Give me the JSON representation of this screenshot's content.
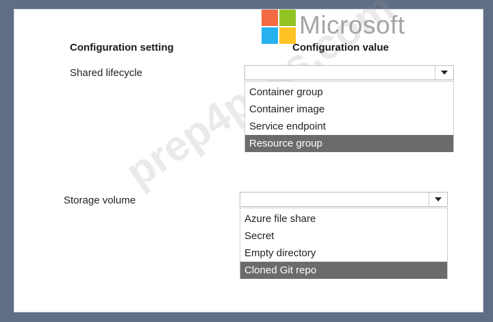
{
  "watermark": {
    "brand": "Microsoft",
    "site": "prep4pass.com",
    "logo_colors": [
      "#f25022",
      "#7fba00",
      "#00a4ef",
      "#ffb900"
    ]
  },
  "headers": {
    "setting": "Configuration setting",
    "value": "Configuration value"
  },
  "rows": [
    {
      "label": "Shared lifecycle",
      "selected_value": "",
      "options": [
        "Container group",
        "Container image",
        "Service endpoint",
        "Resource group"
      ],
      "highlighted": "Resource group"
    },
    {
      "label": "Storage volume",
      "selected_value": "",
      "options": [
        "Azure file share",
        "Secret",
        "Empty directory",
        "Cloned Git repo"
      ],
      "highlighted": "Cloned Git repo"
    }
  ],
  "colors": {
    "highlight": "#6b6b6b",
    "frame": "#5f6d85"
  }
}
